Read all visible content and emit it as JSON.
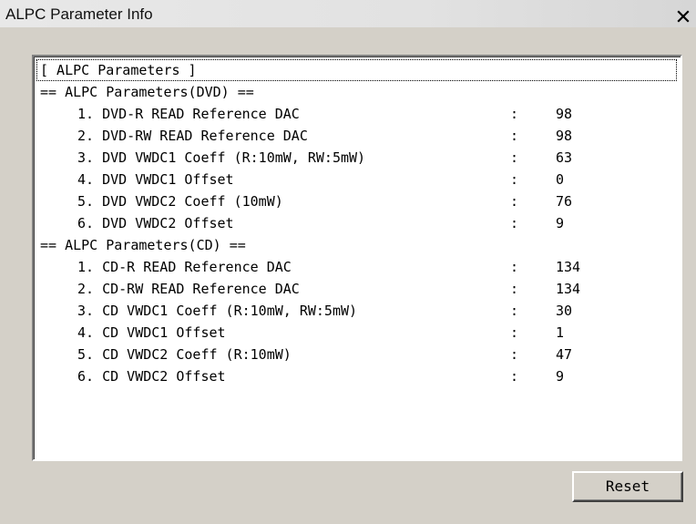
{
  "window": {
    "title": "ALPC Parameter Info",
    "close_icon": "close-icon"
  },
  "listbox": {
    "header": "[ ALPC Parameters ]",
    "dvd_section": "== ALPC Parameters(DVD) ==",
    "dvd_items": [
      {
        "label": "1. DVD-R READ Reference DAC",
        "colon": ":",
        "value": "98"
      },
      {
        "label": "2. DVD-RW READ Reference DAC",
        "colon": ":",
        "value": "98"
      },
      {
        "label": "3. DVD VWDC1 Coeff (R:10mW, RW:5mW)",
        "colon": ":",
        "value": "63"
      },
      {
        "label": "4. DVD VWDC1 Offset",
        "colon": ":",
        "value": "0"
      },
      {
        "label": "5. DVD VWDC2 Coeff (10mW)",
        "colon": ":",
        "value": "76"
      },
      {
        "label": "6. DVD VWDC2 Offset",
        "colon": ":",
        "value": "9"
      }
    ],
    "cd_section": "== ALPC Parameters(CD) ==",
    "cd_items": [
      {
        "label": "1. CD-R READ Reference DAC",
        "colon": ":",
        "value": "134"
      },
      {
        "label": "2. CD-RW READ Reference DAC",
        "colon": ":",
        "value": "134"
      },
      {
        "label": "3. CD VWDC1 Coeff (R:10mW, RW:5mW)",
        "colon": ":",
        "value": "30"
      },
      {
        "label": "4. CD VWDC1 Offset",
        "colon": ":",
        "value": "1"
      },
      {
        "label": "5. CD VWDC2 Coeff (R:10mW)",
        "colon": ":",
        "value": "47"
      },
      {
        "label": "6. CD VWDC2 Offset",
        "colon": ":",
        "value": "9"
      }
    ]
  },
  "buttons": {
    "reset_label": "Reset"
  }
}
